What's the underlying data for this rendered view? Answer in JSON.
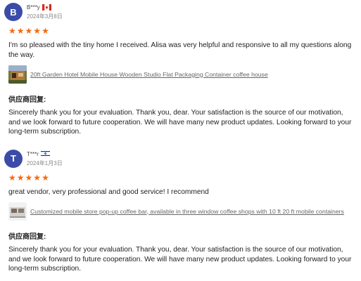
{
  "reviews": [
    {
      "avatar_letter": "B",
      "username": "B***y",
      "flag_icon": "canada-flag-icon",
      "date": "2024年3月8日",
      "rating": 5,
      "text": "I'm so pleased with the tiny home I received. Alisa was very helpful and responsive to all my questions along the way.",
      "product_icon": "mobile-house-thumbnail",
      "product_link": "20ft Garden Hotel Mobile House Wooden Studio Flat Packaging Container coffee house",
      "reply_label": "供应商回复:",
      "reply_text": "Sincerely thank you for your evaluation. Thank you, dear. Your satisfaction is the source of our motivation, and we look forward to future cooperation. We will have many new product updates. Looking forward to your long-term subscription."
    },
    {
      "avatar_letter": "T",
      "username": "T***r",
      "flag_icon": "israel-flag-icon",
      "date": "2024年1月3日",
      "rating": 5,
      "text": "great vendor, very professional and good service! I recommend",
      "product_icon": "coffee-bar-thumbnail",
      "product_link": "Customized mobile store pop-up coffee bar, available in three window coffee shops with 10 ft 20 ft mobile containers",
      "reply_label": "供应商回复:",
      "reply_text": "Sincerely thank you for your evaluation. Thank you, dear. Your satisfaction is the source of our motivation, and we look forward to future cooperation. We will have many new product updates. Looking forward to your long-term subscription."
    }
  ],
  "colors": {
    "avatar_bg": "#3b4ba8",
    "star": "#f5690f",
    "link": "#666666"
  }
}
